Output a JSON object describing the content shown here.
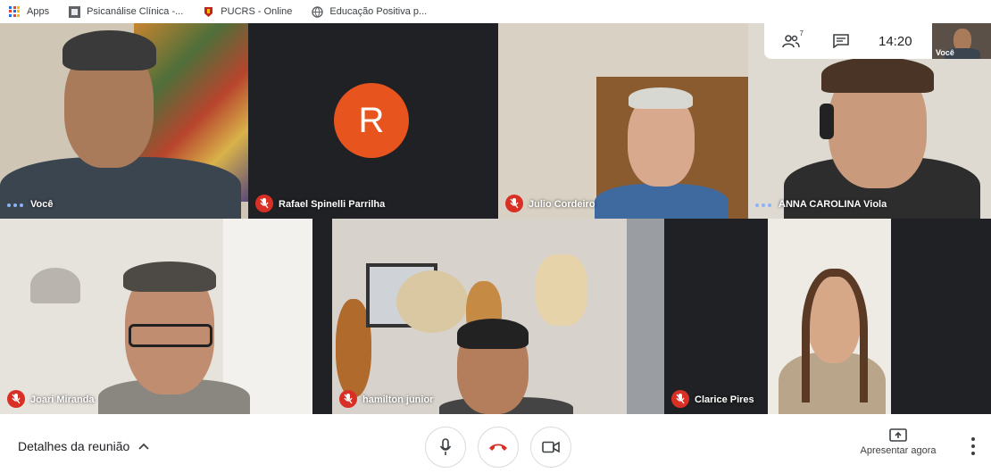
{
  "bookmarks": [
    {
      "label": "Apps",
      "icon": "apps-grid-icon"
    },
    {
      "label": "Psicanálise Clínica -...",
      "icon": "site-favicon"
    },
    {
      "label": "PUCRS - Online",
      "icon": "pucrs-favicon"
    },
    {
      "label": "Educação Positiva p...",
      "icon": "globe-icon"
    }
  ],
  "participants": [
    {
      "name": "Você",
      "muted": false
    },
    {
      "name": "Rafael Spinelli Parrilha",
      "muted": true,
      "avatar_letter": "R"
    },
    {
      "name": "Julio Cordeiro",
      "muted": true
    },
    {
      "name": "ANNA CAROLINA Viola",
      "muted": false
    },
    {
      "name": "Joari Miranda",
      "muted": true
    },
    {
      "name": "hamilton junior",
      "muted": true
    },
    {
      "name": "Clarice Pires",
      "muted": true
    }
  ],
  "info_panel": {
    "participant_count": "7",
    "time": "14:20",
    "self_label": "Você"
  },
  "bottom_bar": {
    "details_label": "Detalhes da reunião",
    "present_label": "Apresentar agora"
  },
  "colors": {
    "muted_red": "#d93025",
    "avatar_orange": "#e8541e",
    "speaking_blue": "#8ab4f8"
  }
}
